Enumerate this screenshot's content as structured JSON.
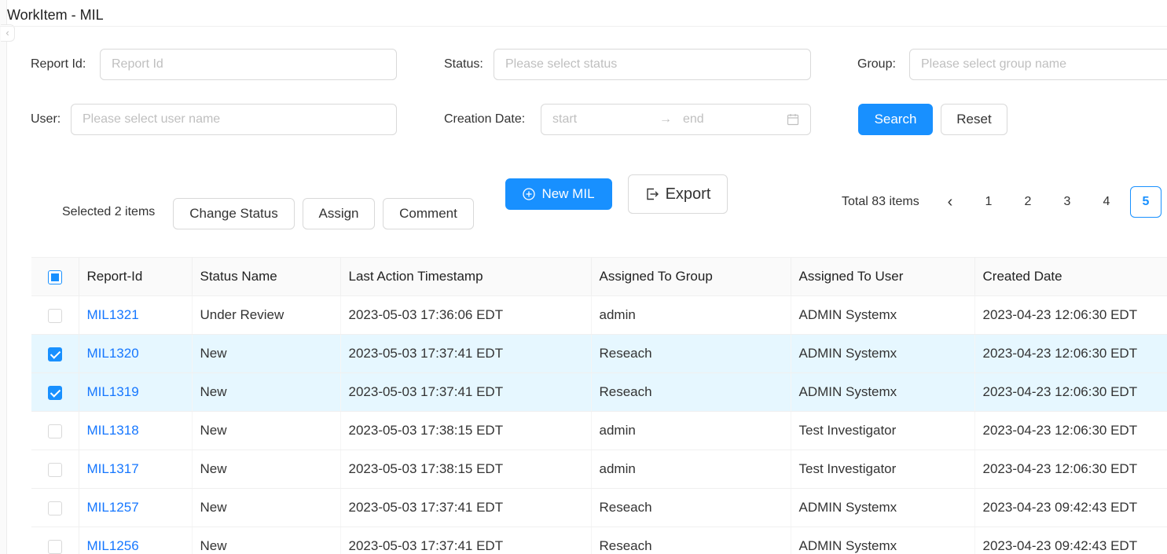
{
  "page": {
    "title": "WorkItem - MIL"
  },
  "filters": {
    "report_id": {
      "label": "Report Id",
      "placeholder": "Report Id",
      "value": ""
    },
    "status": {
      "label": "Status",
      "placeholder": "Please select status"
    },
    "group": {
      "label": "Group",
      "placeholder": "Please select group name"
    },
    "user": {
      "label": "User",
      "placeholder": "Please select user name"
    },
    "creation_date": {
      "label": "Creation Date",
      "start_placeholder": "start",
      "end_placeholder": "end"
    },
    "search_label": "Search",
    "reset_label": "Reset"
  },
  "toolbar": {
    "selected_text": "Selected 2 items",
    "change_status_label": "Change Status",
    "assign_label": "Assign",
    "comment_label": "Comment",
    "new_label": "New MIL",
    "export_label": "Export"
  },
  "pagination": {
    "total_text": "Total 83 items",
    "pages": [
      "1",
      "2",
      "3",
      "4",
      "5"
    ],
    "current": "5"
  },
  "table": {
    "columns": [
      "Report-Id",
      "Status Name",
      "Last Action Timestamp",
      "Assigned To Group",
      "Assigned To User",
      "Created Date"
    ],
    "rows": [
      {
        "selected": false,
        "cells": [
          "MIL1321",
          "Under Review",
          "2023-05-03 17:36:06 EDT",
          "admin",
          "ADMIN Systemx",
          "2023-04-23 12:06:30 EDT"
        ]
      },
      {
        "selected": true,
        "cells": [
          "MIL1320",
          "New",
          "2023-05-03 17:37:41 EDT",
          "Reseach",
          "ADMIN Systemx",
          "2023-04-23 12:06:30 EDT"
        ]
      },
      {
        "selected": true,
        "cells": [
          "MIL1319",
          "New",
          "2023-05-03 17:37:41 EDT",
          "Reseach",
          "ADMIN Systemx",
          "2023-04-23 12:06:30 EDT"
        ]
      },
      {
        "selected": false,
        "cells": [
          "MIL1318",
          "New",
          "2023-05-03 17:38:15 EDT",
          "admin",
          "Test Investigator",
          "2023-04-23 12:06:30 EDT"
        ]
      },
      {
        "selected": false,
        "cells": [
          "MIL1317",
          "New",
          "2023-05-03 17:38:15 EDT",
          "admin",
          "Test Investigator",
          "2023-04-23 12:06:30 EDT"
        ]
      },
      {
        "selected": false,
        "cells": [
          "MIL1257",
          "New",
          "2023-05-03 17:37:41 EDT",
          "Reseach",
          "ADMIN Systemx",
          "2023-04-23 09:42:43 EDT"
        ]
      },
      {
        "selected": false,
        "cells": [
          "MIL1256",
          "New",
          "2023-05-03 17:37:41 EDT",
          "Reseach",
          "ADMIN Systemx",
          "2023-04-23 09:42:43 EDT"
        ]
      }
    ]
  },
  "theme": {
    "primary": "#1890ff",
    "link": "#1677ff",
    "selected_row": "#e6f7ff"
  },
  "icons": {
    "collapse": "chevron-left-icon",
    "calendar": "calendar-icon",
    "new": "plus-circle-icon",
    "export": "export-icon",
    "prev": "chevron-left-icon"
  }
}
